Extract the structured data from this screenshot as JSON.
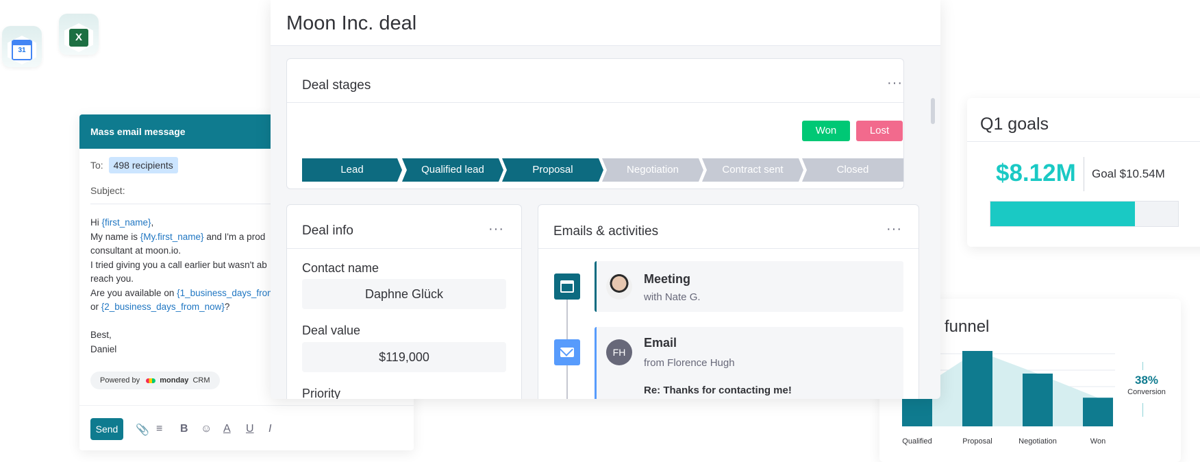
{
  "integrations": [
    {
      "name": "google-calendar",
      "label": "31"
    },
    {
      "name": "excel",
      "label": "X"
    }
  ],
  "email": {
    "header": "Mass email message",
    "to_label": "To:",
    "recipients": "498 recipients",
    "subject_label": "Subject:",
    "body": {
      "l1_a": "Hi ",
      "l1_tok": "{first_name}",
      "l1_b": ",",
      "l2_a": "My name is ",
      "l2_tok": "{My.first_name}",
      "l2_b": " and I'm a prod",
      "l3": "consultant at moon.io.",
      "l4": "I tried giving you a call earlier but wasn't ab",
      "l5": "reach you.",
      "l6_a": "Are you available on ",
      "l6_tok": "{1_business_days_from",
      "l7_a": "or ",
      "l7_tok": "{2_business_days_from_now}",
      "l7_b": "?",
      "l8": "Best,",
      "l9": "Daniel"
    },
    "powered_by": "Powered by",
    "brand": "monday",
    "brand_suffix": "CRM",
    "send": "Send"
  },
  "deal": {
    "title": "Moon Inc. deal",
    "stages_title": "Deal stages",
    "won": "Won",
    "lost": "Lost",
    "stages": [
      {
        "label": "Lead",
        "active": true
      },
      {
        "label": "Qualified lead",
        "active": true
      },
      {
        "label": "Proposal",
        "active": true
      },
      {
        "label": "Negotiation",
        "active": false
      },
      {
        "label": "Contract sent",
        "active": false
      },
      {
        "label": "Closed",
        "active": false
      }
    ],
    "info": {
      "title": "Deal info",
      "contact_label": "Contact name",
      "contact_value": "Daphne Glück",
      "value_label": "Deal value",
      "value_value": "$119,000",
      "priority_label": "Priority"
    },
    "activities": {
      "title": "Emails & activities",
      "meeting_title": "Meeting",
      "meeting_sub": "with Nate G.",
      "email_title": "Email",
      "email_from": "from Florence Hugh",
      "email_initials": "FH",
      "email_subject": "Re: Thanks for contacting me!"
    },
    "more": "···"
  },
  "goals": {
    "title": "Q1 goals",
    "amount": "$8.12M",
    "goal": "Goal $10.54M",
    "progress": 0.77,
    "accent": "#1ac9c4"
  },
  "funnel": {
    "title": "funnel",
    "conversion_pct": "38%",
    "conversion_label": "Conversion",
    "categories": [
      "Qualified",
      "Proposal",
      "Negotiation",
      "Won"
    ],
    "values": [
      48,
      100,
      70,
      38
    ]
  },
  "colors": {
    "teal": "#0f7b8f",
    "stage_active": "#0d6b80",
    "won": "#00c875",
    "lost": "#f26a8d",
    "meeting_tile": "#0d6b80",
    "email_tile": "#579bfc"
  }
}
